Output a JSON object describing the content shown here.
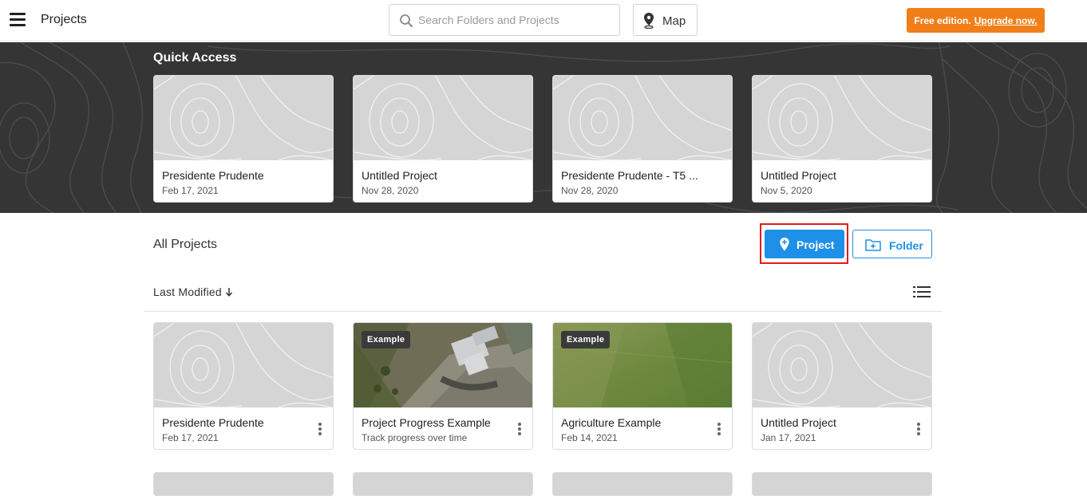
{
  "header": {
    "title": "Projects",
    "search_placeholder": "Search Folders and Projects",
    "map_label": "Map",
    "upgrade_prefix": "Free edition.",
    "upgrade_link": "Upgrade now.",
    "upgrade_color": "#f07f1a"
  },
  "quick_access": {
    "title": "Quick Access",
    "items": [
      {
        "name": "Presidente Prudente",
        "date": "Feb 17, 2021"
      },
      {
        "name": "Untitled Project",
        "date": "Nov 28, 2020"
      },
      {
        "name": "Presidente Prudente - T5 ...",
        "date": "Nov 28, 2020"
      },
      {
        "name": "Untitled Project",
        "date": "Nov 5, 2020"
      }
    ]
  },
  "all_projects": {
    "title": "All Projects",
    "new_project_label": "Project",
    "new_folder_label": "Folder",
    "sort_label": "Last Modified",
    "accent_color": "#1e90e8",
    "items": [
      {
        "name": "Presidente Prudente",
        "subtitle": "Feb 17, 2021",
        "badge": "",
        "thumb": "topo"
      },
      {
        "name": "Project Progress Example",
        "subtitle": "Track progress over time",
        "badge": "Example",
        "thumb": "aerial-building"
      },
      {
        "name": "Agriculture Example",
        "subtitle": "Feb 14, 2021",
        "badge": "Example",
        "thumb": "aerial-field"
      },
      {
        "name": "Untitled Project",
        "subtitle": "Jan 17, 2021",
        "badge": "",
        "thumb": "topo"
      }
    ]
  }
}
